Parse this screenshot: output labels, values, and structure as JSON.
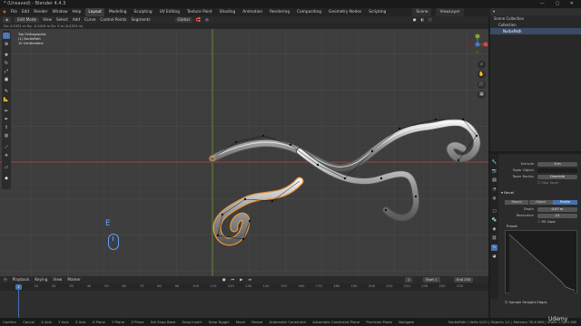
{
  "window": {
    "title": "* (Unsaved) - Blender 4.4.3",
    "controls": "— ▢ ✕"
  },
  "menu": {
    "items": [
      "File",
      "Edit",
      "Render",
      "Window",
      "Help"
    ],
    "workspaces": [
      "Layout",
      "Modeling",
      "Sculpting",
      "UV Editing",
      "Texture Paint",
      "Shading",
      "Animation",
      "Rendering",
      "Compositing",
      "Geometry Nodes",
      "Scripting"
    ],
    "active_workspace": "Layout",
    "scene": "Scene",
    "view_layer": "ViewLayer"
  },
  "viewport_header": {
    "mode": "Edit Mode",
    "menus": [
      "View",
      "Select",
      "Add",
      "Curve",
      "Control Points",
      "Segments"
    ],
    "orientation": "Global"
  },
  "viewport_stats": "Dx: 0.1551 m   Dy: -0.4419 m   Dz: 0 m (0.4323 m)",
  "overlay": {
    "line1": "Top Orthographic",
    "line2": "(1) NurbsPath",
    "line3": "10 Centimeters"
  },
  "key_hint": "E",
  "colors": {
    "accent": "#4772b3",
    "x_axis": "#b8453f",
    "y_axis": "#6e9a2c",
    "curve_select": "#e8963c",
    "hint": "#5aa0ff"
  },
  "outliner": {
    "header": "Scene Collection",
    "rows": [
      "Scene Collection",
      "Collection",
      "NurbsPath"
    ],
    "selected": "NurbsPath"
  },
  "properties": {
    "extrude_label": "Extrude",
    "extrude_value": "0 m",
    "taper_object_label": "Taper Object",
    "taper_radius_label": "Taper Radius",
    "taper_radius_value": "Override",
    "map_taper": "Map Taper",
    "bevel_section": "Bevel",
    "bevel_modes": [
      "Round",
      "Object",
      "Profile"
    ],
    "bevel_active": "Profile",
    "depth_label": "Depth",
    "depth_value": "0.07 m",
    "resolution_label": "Resolution",
    "resolution_value": "21",
    "fill_caps": "Fill Caps",
    "preset_label": "Preset",
    "sample_straight": "Sample Straight Edges"
  },
  "timeline": {
    "menus": [
      "Playback",
      "Keying",
      "View",
      "Marker"
    ],
    "current_frame": "1",
    "start_label": "Start",
    "start_value": "1",
    "end_label": "End",
    "end_value": "250",
    "ticks": [
      "1",
      "10",
      "20",
      "30",
      "40",
      "50",
      "60",
      "70",
      "80",
      "90",
      "100",
      "110",
      "120",
      "130",
      "140",
      "150",
      "160",
      "170",
      "180",
      "190",
      "200",
      "210",
      "220",
      "230",
      "240",
      "250"
    ]
  },
  "statusbar": {
    "items": [
      "Confirm",
      "Cancel",
      "X Axis",
      "Y Axis",
      "Z Axis",
      "X Plane",
      "Y Plane",
      "Z Plane",
      "Set Snap Base",
      "Snap Invert",
      "Snap Toggle",
      "Move",
      "Resize",
      "Automatic Constraint",
      "Automatic Constraint Plane",
      "Precision Mode",
      "Navigate"
    ],
    "info": "NurbsPath | Verts 0/10 | Objects 1/1 | Memory 35.6 MiB | VRAM 1.9/24 GiB"
  },
  "watermark": "Udemy"
}
